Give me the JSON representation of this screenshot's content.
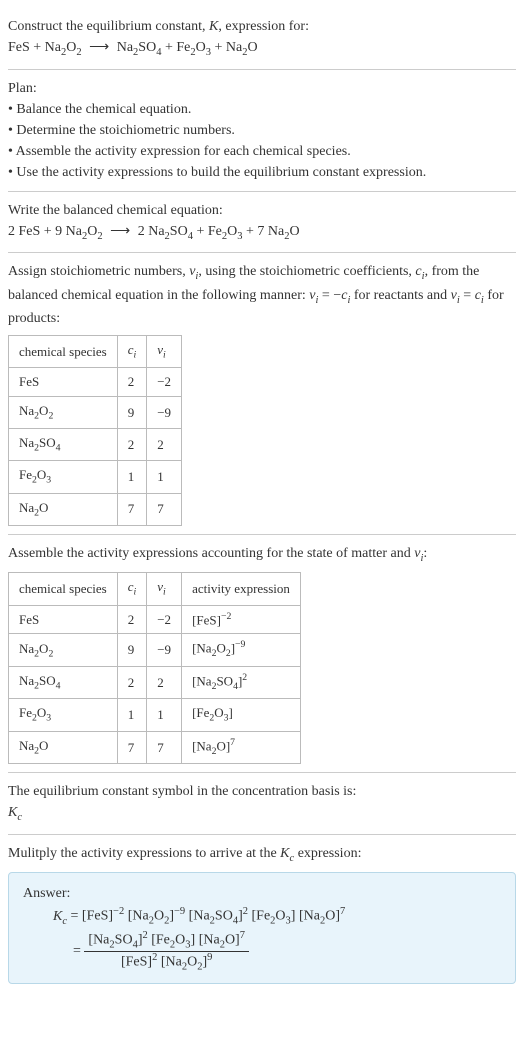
{
  "s1": {
    "title": "Construct the equilibrium constant, <span class=\"ital\">K</span>, expression for:",
    "equation": "FeS + Na<span class=\"sub\">2</span>O<span class=\"sub\">2</span> <span class=\"arrow\">⟶</span> Na<span class=\"sub\">2</span>SO<span class=\"sub\">4</span> + Fe<span class=\"sub\">2</span>O<span class=\"sub\">3</span> + Na<span class=\"sub\">2</span>O"
  },
  "s2": {
    "title": "Plan:",
    "b1": "• Balance the chemical equation.",
    "b2": "• Determine the stoichiometric numbers.",
    "b3": "• Assemble the activity expression for each chemical species.",
    "b4": "• Use the activity expressions to build the equilibrium constant expression."
  },
  "s3": {
    "title": "Write the balanced chemical equation:",
    "equation": "2 FeS + 9 Na<span class=\"sub\">2</span>O<span class=\"sub\">2</span> <span class=\"arrow\">⟶</span> 2 Na<span class=\"sub\">2</span>SO<span class=\"sub\">4</span> + Fe<span class=\"sub\">2</span>O<span class=\"sub\">3</span> + 7 Na<span class=\"sub\">2</span>O"
  },
  "s4": {
    "intro": "Assign stoichiometric numbers, <span class=\"ital\">ν<span class=\"sub\">i</span></span>, using the stoichiometric coefficients, <span class=\"ital\">c<span class=\"sub\">i</span></span>, from the balanced chemical equation in the following manner: <span class=\"ital\">ν<span class=\"sub\">i</span></span> = −<span class=\"ital\">c<span class=\"sub\">i</span></span> for reactants and <span class=\"ital\">ν<span class=\"sub\">i</span></span> = <span class=\"ital\">c<span class=\"sub\">i</span></span> for products:",
    "h1": "chemical species",
    "h2": "<span class=\"ital\">c<span class=\"sub\">i</span></span>",
    "h3": "<span class=\"ital\">ν<span class=\"sub\">i</span></span>",
    "r1c1": "FeS",
    "r1c2": "2",
    "r1c3": "−2",
    "r2c1": "Na<span class=\"sub\">2</span>O<span class=\"sub\">2</span>",
    "r2c2": "9",
    "r2c3": "−9",
    "r3c1": "Na<span class=\"sub\">2</span>SO<span class=\"sub\">4</span>",
    "r3c2": "2",
    "r3c3": "2",
    "r4c1": "Fe<span class=\"sub\">2</span>O<span class=\"sub\">3</span>",
    "r4c2": "1",
    "r4c3": "1",
    "r5c1": "Na<span class=\"sub\">2</span>O",
    "r5c2": "7",
    "r5c3": "7"
  },
  "s5": {
    "intro": "Assemble the activity expressions accounting for the state of matter and <span class=\"ital\">ν<span class=\"sub\">i</span></span>:",
    "h1": "chemical species",
    "h2": "<span class=\"ital\">c<span class=\"sub\">i</span></span>",
    "h3": "<span class=\"ital\">ν<span class=\"sub\">i</span></span>",
    "h4": "activity expression",
    "r1c1": "FeS",
    "r1c2": "2",
    "r1c3": "−2",
    "r1c4": "[FeS]<span class=\"sup\">−2</span>",
    "r2c1": "Na<span class=\"sub\">2</span>O<span class=\"sub\">2</span>",
    "r2c2": "9",
    "r2c3": "−9",
    "r2c4": "[Na<span class=\"sub\">2</span>O<span class=\"sub\">2</span>]<span class=\"sup\">−9</span>",
    "r3c1": "Na<span class=\"sub\">2</span>SO<span class=\"sub\">4</span>",
    "r3c2": "2",
    "r3c3": "2",
    "r3c4": "[Na<span class=\"sub\">2</span>SO<span class=\"sub\">4</span>]<span class=\"sup\">2</span>",
    "r4c1": "Fe<span class=\"sub\">2</span>O<span class=\"sub\">3</span>",
    "r4c2": "1",
    "r4c3": "1",
    "r4c4": "[Fe<span class=\"sub\">2</span>O<span class=\"sub\">3</span>]",
    "r5c1": "Na<span class=\"sub\">2</span>O",
    "r5c2": "7",
    "r5c3": "7",
    "r5c4": "[Na<span class=\"sub\">2</span>O]<span class=\"sup\">7</span>"
  },
  "s6": {
    "t1": "The equilibrium constant symbol in the concentration basis is:",
    "t2": "<span class=\"ital\">K<span class=\"sub\">c</span></span>"
  },
  "s7": {
    "intro": "Mulitply the activity expressions to arrive at the <span class=\"ital\">K<span class=\"sub\">c</span></span> expression:",
    "answer_label": "Answer:",
    "line1": "<span class=\"ital\">K<span class=\"sub\">c</span></span> = [FeS]<span class=\"sup\">−2</span> [Na<span class=\"sub\">2</span>O<span class=\"sub\">2</span>]<span class=\"sup\">−9</span> [Na<span class=\"sub\">2</span>SO<span class=\"sub\">4</span>]<span class=\"sup\">2</span> [Fe<span class=\"sub\">2</span>O<span class=\"sub\">3</span>] [Na<span class=\"sub\">2</span>O]<span class=\"sup\">7</span>",
    "eq": "= ",
    "num": "[Na<span class=\"sub\">2</span>SO<span class=\"sub\">4</span>]<span class=\"sup\">2</span> [Fe<span class=\"sub\">2</span>O<span class=\"sub\">3</span>] [Na<span class=\"sub\">2</span>O]<span class=\"sup\">7</span>",
    "den": "[FeS]<span class=\"sup\">2</span> [Na<span class=\"sub\">2</span>O<span class=\"sub\">2</span>]<span class=\"sup\">9</span>"
  }
}
